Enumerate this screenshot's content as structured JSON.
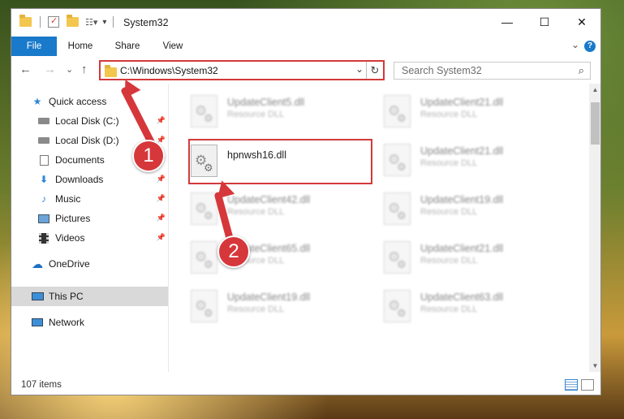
{
  "window": {
    "title": "System32",
    "minimize": "—",
    "maximize": "☐",
    "close": "✕"
  },
  "ribbon": {
    "tabs": [
      "File",
      "Home",
      "Share",
      "View"
    ],
    "expand_caret": "⌄",
    "help": "?"
  },
  "address": {
    "path": "C:\\Windows\\System32",
    "caret": "⌄",
    "refresh": "↻"
  },
  "search": {
    "placeholder": "Search System32",
    "icon": "search-icon"
  },
  "nav": {
    "back": "←",
    "forward": "→",
    "recent": "⌄",
    "up": "↑",
    "items": [
      {
        "label": "Quick access",
        "icon": "star-icon",
        "pinned": false
      },
      {
        "label": "Local Disk (C:)",
        "icon": "drive-icon",
        "pinned": true
      },
      {
        "label": "Local Disk (D:)",
        "icon": "drive-icon",
        "pinned": true
      },
      {
        "label": "Documents",
        "icon": "documents-icon",
        "pinned": true
      },
      {
        "label": "Downloads",
        "icon": "download-icon",
        "pinned": true
      },
      {
        "label": "Music",
        "icon": "music-icon",
        "pinned": true
      },
      {
        "label": "Pictures",
        "icon": "pictures-icon",
        "pinned": true
      },
      {
        "label": "Videos",
        "icon": "videos-icon",
        "pinned": true
      },
      {
        "label": "OneDrive",
        "icon": "cloud-icon",
        "pinned": false
      },
      {
        "label": "This PC",
        "icon": "computer-icon",
        "pinned": false,
        "selected": true
      },
      {
        "label": "Network",
        "icon": "network-icon",
        "pinned": false
      }
    ]
  },
  "files": {
    "left": [
      {
        "name": "UpdateClient5.dll",
        "type": "Resource DLL",
        "blurred": true
      },
      {
        "name": "hpnwsh16.dll",
        "type": "",
        "blurred": false,
        "highlighted": true
      },
      {
        "name": "UpdateClient42.dll",
        "type": "Resource DLL",
        "blurred": true
      },
      {
        "name": "UpdateClient65.dll",
        "type": "Resource DLL",
        "blurred": true
      },
      {
        "name": "UpdateClient19.dll",
        "type": "Resource DLL",
        "blurred": true
      }
    ],
    "right": [
      {
        "name": "UpdateClient21.dll",
        "type": "Resource DLL",
        "blurred": true
      },
      {
        "name": "UpdateClient21.dll",
        "type": "Resource DLL",
        "blurred": true
      },
      {
        "name": "UpdateClient19.dll",
        "type": "Resource DLL",
        "blurred": true
      },
      {
        "name": "UpdateClient21.dll",
        "type": "Resource DLL",
        "blurred": true
      },
      {
        "name": "UpdateClient63.dll",
        "type": "Resource DLL",
        "blurred": true
      }
    ]
  },
  "status": {
    "item_count": "107 items"
  },
  "annotations": {
    "step1": "1",
    "step2": "2",
    "color": "#d6373b"
  }
}
